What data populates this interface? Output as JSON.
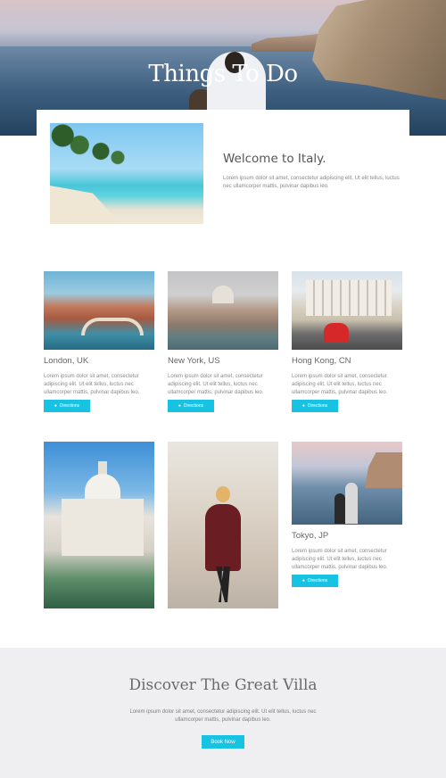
{
  "hero": {
    "title": "Things To Do"
  },
  "welcome": {
    "title": "Welcome to Italy.",
    "text": "Lorem ipsum dolor sit amet, consectetur adipiscing elit. Ut elit tellus, luctus nec ullamcorper mattis, pulvinar dapibus leo."
  },
  "cards": [
    {
      "title": "London, UK",
      "text": "Lorem ipsum dolor sit amet, consectetur adipiscing elit. Ut elit tellus, luctus nec ullamcorper mattis, pulvinar dapibus leo.",
      "button": "Directions"
    },
    {
      "title": "New York, US",
      "text": "Lorem ipsum dolor sit amet, consectetur adipiscing elit. Ut elit tellus, luctus nec ullamcorper mattis, pulvinar dapibus leo.",
      "button": "Directions"
    },
    {
      "title": "Hong Kong, CN",
      "text": "Lorem ipsum dolor sit amet, consectetur adipiscing elit. Ut elit tellus, luctus nec ullamcorper mattis, pulvinar dapibus leo.",
      "button": "Directions"
    },
    {
      "title": "Tokyo, JP",
      "text": "Lorem ipsum dolor sit amet, consectetur adipiscing elit. Ut elit tellus, luctus nec ullamcorper mattis, pulvinar dapibus leo.",
      "button": "Directions"
    }
  ],
  "cta": {
    "title": "Discover The Great Villa",
    "text": "Lorem ipsum dolor sit amet, consectetur adipiscing elit. Ut elit tellus, luctus nec ullamcorper mattis, pulvinar dapibus leo.",
    "button": "Book Now"
  },
  "icons": {
    "directions": "map-pin-icon"
  },
  "colors": {
    "accent": "#17c2e3",
    "cta_background": "#efeff2"
  }
}
